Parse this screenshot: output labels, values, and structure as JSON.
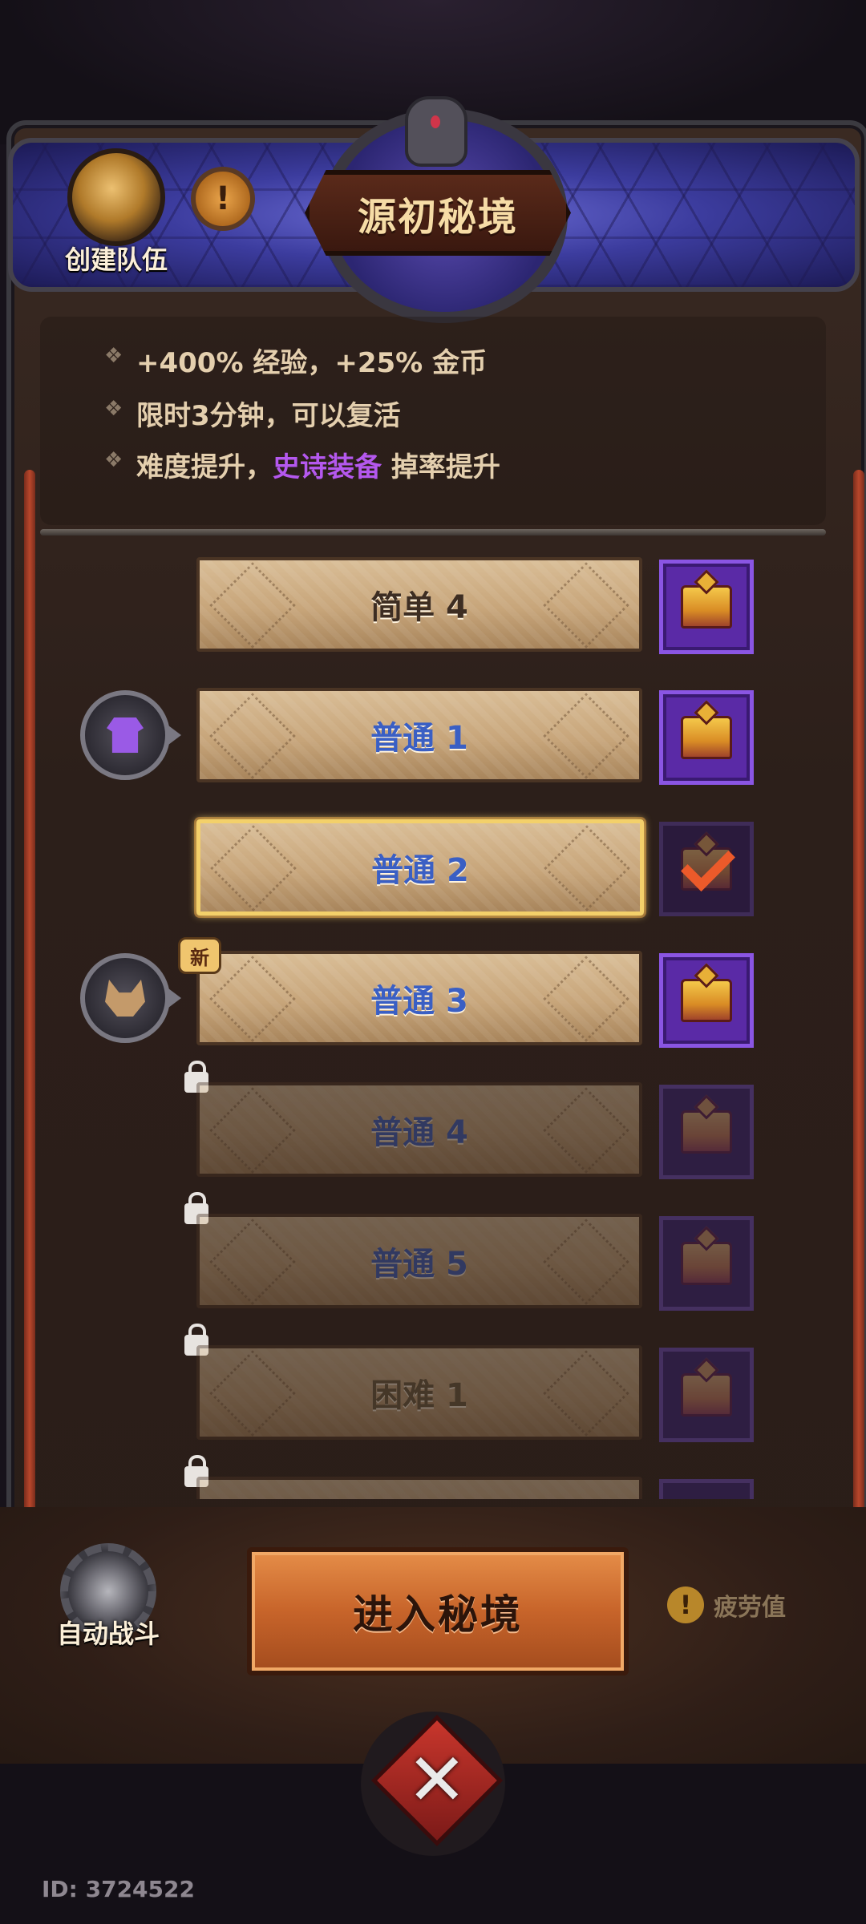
{
  "header": {
    "title": "源初秘境",
    "team_label": "创建队伍",
    "info_icon": "!"
  },
  "bonuses": [
    "+400% 经验，+25% 金币",
    "限时3分钟，可以复活",
    {
      "prefix": "难度提升，",
      "highlight": "史诗装备",
      "suffix": " 掉率提升"
    }
  ],
  "colors": {
    "epic": "#b458ee",
    "normal_label": "#3a5fc4",
    "selected_border": "#f3d06a"
  },
  "levels": [
    {
      "label": "简单 4",
      "state": "unlocked",
      "reward": "chest"
    },
    {
      "label": "普通 1",
      "state": "unlocked",
      "reward": "chest",
      "side_reward": "armor-icon"
    },
    {
      "label": "普通 2",
      "state": "selected",
      "reward": "claimed"
    },
    {
      "label": "普通 3",
      "state": "unlocked",
      "reward": "chest",
      "side_reward": "dog-icon",
      "badge": "新"
    },
    {
      "label": "普通 4",
      "state": "locked",
      "reward": "chest"
    },
    {
      "label": "普通 5",
      "state": "locked",
      "reward": "chest"
    },
    {
      "label": "困难 1",
      "state": "locked",
      "reward": "chest"
    }
  ],
  "actions": {
    "auto_battle": "自动战斗",
    "enter": "进入秘境",
    "fatigue": "疲劳值",
    "fatigue_icon": "!"
  },
  "user_id": "ID: 3724522"
}
